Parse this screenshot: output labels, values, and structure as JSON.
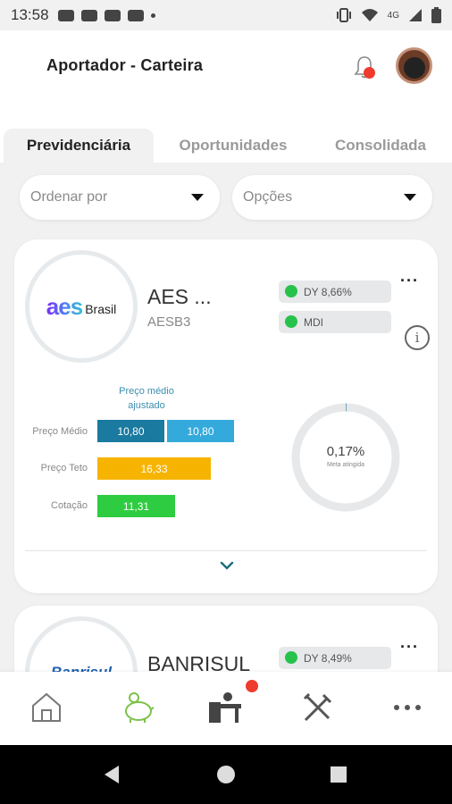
{
  "status_bar": {
    "time": "13:58",
    "network": "4G"
  },
  "header": {
    "title": "Aportador - Carteira"
  },
  "tabs": [
    {
      "label": "Previdenciária",
      "active": true
    },
    {
      "label": "Oportunidades",
      "active": false
    },
    {
      "label": "Consolidada",
      "active": false
    }
  ],
  "filters": {
    "sort_label": "Ordenar por",
    "options_label": "Opções"
  },
  "cards": [
    {
      "logo_aes": "aes",
      "logo_brasil": "Brasil",
      "name": "AES ...",
      "ticker": "AESB3",
      "badges": [
        "DY 8,66%",
        "MDI"
      ],
      "chart_title": "Preço médio ajustado",
      "rows": {
        "preco_medio": {
          "label": "Preço Médio",
          "value": "10,80",
          "adjusted": "10,80"
        },
        "preco_teto": {
          "label": "Preço Teto",
          "value": "16,33"
        },
        "cotacao": {
          "label": "Cotação",
          "value": "11,31"
        }
      },
      "goal": {
        "value": "0,17%",
        "label": "Meta atingida",
        "fraction": 0.0017
      }
    },
    {
      "logo": "Banrisul",
      "name": "BANRISUL",
      "badges": [
        "DY 8,49%"
      ]
    }
  ],
  "chart_data": {
    "type": "bar",
    "categories": [
      "Preço Médio",
      "Preço Teto",
      "Cotação"
    ],
    "series": [
      {
        "name": "Preço médio ajustado",
        "values": [
          10.8,
          null,
          null
        ]
      },
      {
        "name": "",
        "values": [
          10.8,
          16.33,
          11.31
        ]
      }
    ],
    "title": "Preço médio ajustado"
  },
  "colors": {
    "bar_preco_medio": "#1a7aa0",
    "bar_preco_medio_adj": "#34aadc",
    "bar_preco_teto": "#f6b400",
    "bar_cotacao": "#2ecc40",
    "badge_dot": "#27c24c",
    "notification": "#ef3b2d",
    "accent": "#1a6f7a"
  },
  "icons": {
    "header": [
      "bell-icon",
      "avatar"
    ],
    "bottom_nav": [
      "home-icon",
      "piggy-bank-icon",
      "desk-icon",
      "tools-icon",
      "more-icon"
    ],
    "system_nav": [
      "back-icon",
      "home-circle-icon",
      "recents-icon"
    ]
  }
}
